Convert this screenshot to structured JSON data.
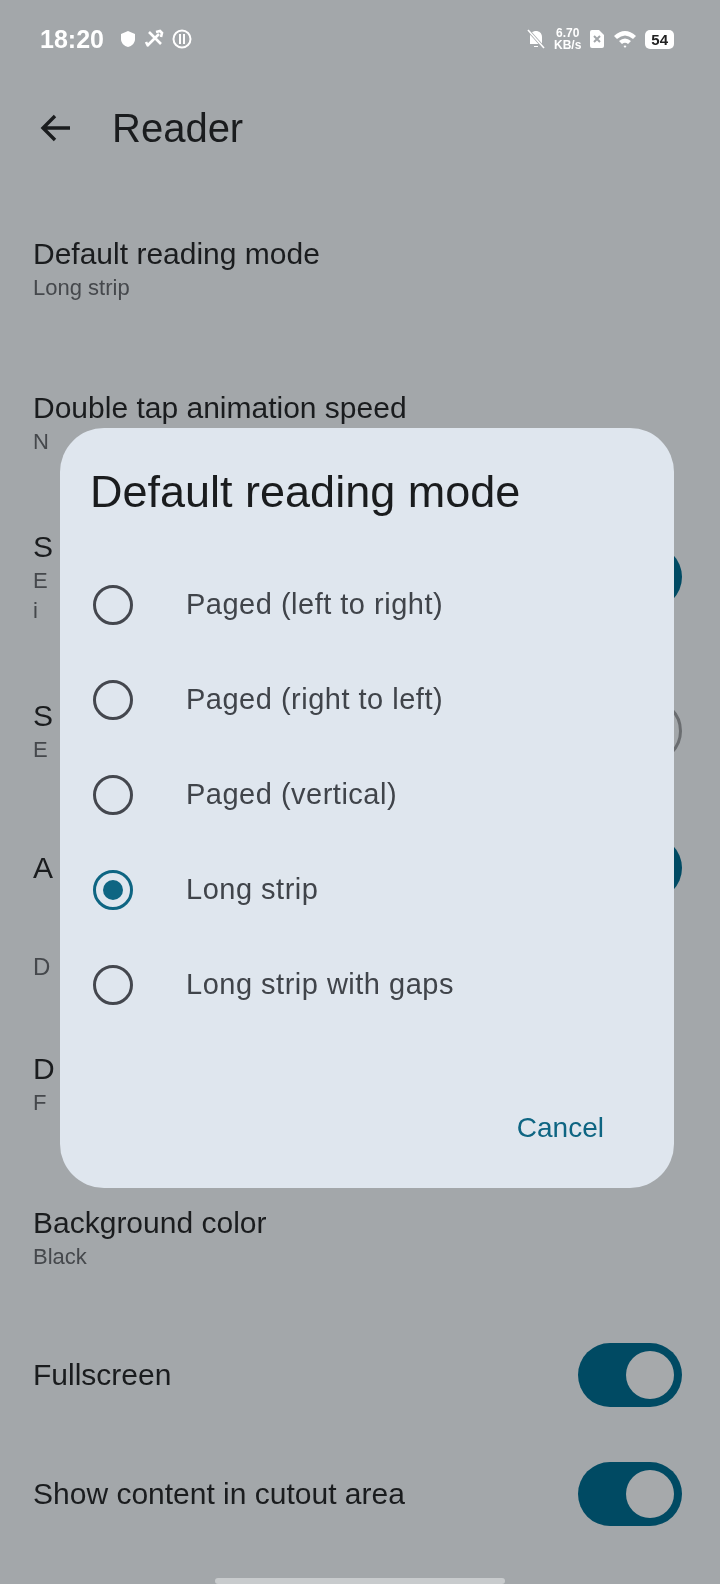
{
  "status_bar": {
    "time": "18:20",
    "net_speed": "6.70",
    "net_unit": "KB/s",
    "battery": "54"
  },
  "header": {
    "title": "Reader"
  },
  "settings": [
    {
      "kind": "setting",
      "title": "Default reading mode",
      "subtitle_lines": [
        "Long strip"
      ]
    },
    {
      "kind": "setting",
      "title": "Double tap animation speed",
      "subtitle_lines": [
        "N"
      ]
    },
    {
      "kind": "toggle",
      "title": "S",
      "subtitle_lines": [
        "E",
        "i"
      ],
      "on": true
    },
    {
      "kind": "toggle",
      "title": "S",
      "subtitle_lines": [
        "E"
      ],
      "on": false
    },
    {
      "kind": "toggle",
      "title": "A",
      "on": true
    },
    {
      "kind": "header",
      "title": "D"
    },
    {
      "kind": "setting",
      "title": "D",
      "subtitle_lines": [
        "F"
      ]
    },
    {
      "kind": "setting",
      "title": "Background color",
      "subtitle_lines": [
        "Black"
      ]
    },
    {
      "kind": "toggle",
      "title": "Fullscreen",
      "on": true
    },
    {
      "kind": "toggle",
      "title": "Show content in cutout area",
      "on": true
    }
  ],
  "dialog": {
    "title": "Default reading mode",
    "options": [
      {
        "label": "Paged (left to right)",
        "selected": false
      },
      {
        "label": "Paged (right to left)",
        "selected": false
      },
      {
        "label": "Paged (vertical)",
        "selected": false
      },
      {
        "label": "Long strip",
        "selected": true
      },
      {
        "label": "Long strip with gaps",
        "selected": false
      }
    ],
    "cancel": "Cancel"
  }
}
